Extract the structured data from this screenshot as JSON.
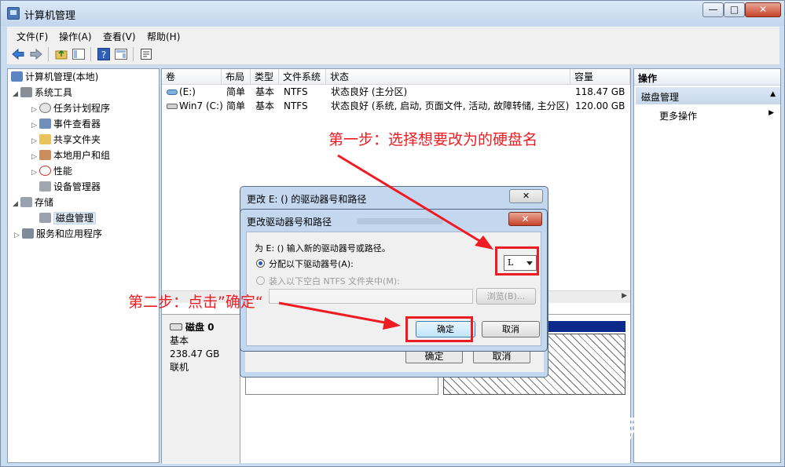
{
  "window": {
    "title": "计算机管理",
    "buttons": {
      "minimize": "—",
      "maximize": "□",
      "close": "✕"
    }
  },
  "menu": [
    "文件(F)",
    "操作(A)",
    "查看(V)",
    "帮助(H)"
  ],
  "toolbar": [
    "back-icon",
    "forward-icon",
    "up-folder-icon",
    "show-hide-tree-icon",
    "help-icon",
    "properties-icon",
    "export-icon"
  ],
  "tree": {
    "root": "计算机管理(本地)",
    "system_tools": "系统工具",
    "task_scheduler": "任务计划程序",
    "event_viewer": "事件查看器",
    "shared_folders": "共享文件夹",
    "local_users": "本地用户和组",
    "performance": "性能",
    "device_manager": "设备管理器",
    "storage": "存储",
    "disk_management": "磁盘管理",
    "services": "服务和应用程序"
  },
  "volumes": {
    "headers": [
      "卷",
      "布局",
      "类型",
      "文件系统",
      "状态",
      "容量"
    ],
    "rows": [
      [
        "(E:)",
        "简单",
        "基本",
        "NTFS",
        "状态良好 (主分区)",
        "118.47 GB"
      ],
      [
        "Win7 (C:)",
        "简单",
        "基本",
        "NTFS",
        "状态良好 (系统, 启动, 页面文件, 活动, 故障转储, 主分区)",
        "120.00 GB"
      ]
    ]
  },
  "disk": {
    "name": "磁盘 0",
    "type": "基本",
    "size": "238.47 GB",
    "status": "联机"
  },
  "actions": {
    "header": "操作",
    "section": "磁盘管理",
    "more": "更多操作"
  },
  "dialog_back": {
    "title": "更改 E: () 的驱动器号和路径",
    "ok": "确定",
    "cancel": "取消"
  },
  "dialog_front": {
    "title": "更改驱动器号和路径",
    "prompt": "为 E: () 输入新的驱动器号或路径。",
    "option_assign": "分配以下驱动器号(A):",
    "option_mount": "装入以下空白 NTFS 文件夹中(M):",
    "selected_letter": "L",
    "browse": "浏览(B)...",
    "ok": "确定",
    "cancel": "取消"
  },
  "annotations": {
    "step1": "第一步：选择想要改为的硬盘名",
    "step2": "第二步：点击”确定“"
  },
  "watermark": {
    "brand": "Bai du 经验",
    "url": "jingyan.baidu.com"
  },
  "colors": {
    "annotation": "#ee1b22",
    "partition_bar": "#0c2a8c",
    "title_bar": "#c3d6ed"
  }
}
